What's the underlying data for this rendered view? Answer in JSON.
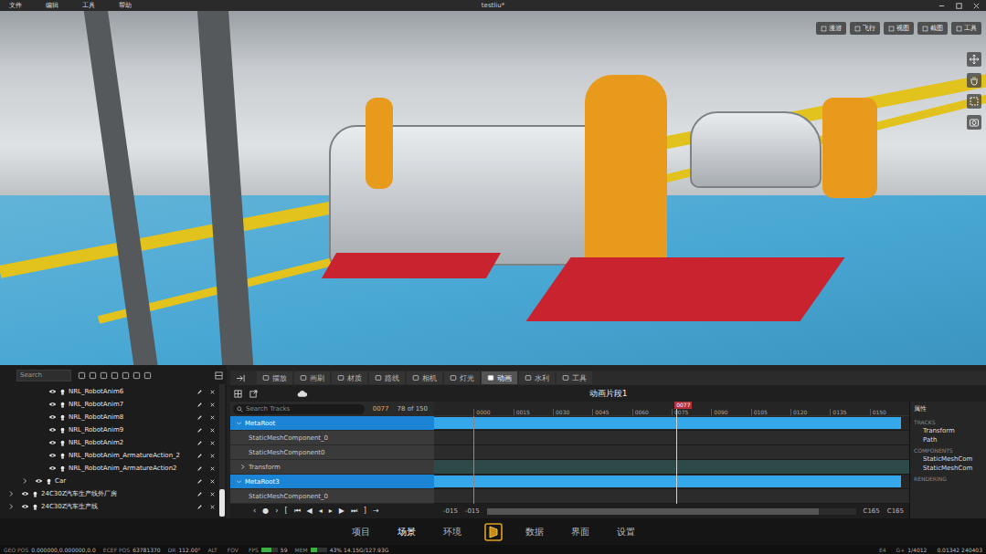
{
  "window": {
    "title": "testliu*",
    "menu": [
      "文件",
      "编辑",
      "工具",
      "帮助"
    ]
  },
  "viewport": {
    "toolbar": [
      "漫游",
      "飞行",
      "视图",
      "截图",
      "工具"
    ]
  },
  "scene_tree": {
    "search": {
      "placeholder": "Search"
    },
    "items": [
      {
        "label": "NRL_RobotAnim6",
        "depth": 2,
        "has_children": false,
        "expanded": false
      },
      {
        "label": "NRL_RobotAnim7",
        "depth": 2,
        "has_children": false,
        "expanded": false
      },
      {
        "label": "NRL_RobotAnim8",
        "depth": 2,
        "has_children": false,
        "expanded": false
      },
      {
        "label": "NRL_RobotAnim9",
        "depth": 2,
        "has_children": false,
        "expanded": false
      },
      {
        "label": "NRL_RobotAnim2",
        "depth": 2,
        "has_children": false,
        "expanded": false
      },
      {
        "label": "NRL_RobotAnim_ArmatureAction_2",
        "depth": 2,
        "has_children": false,
        "expanded": false
      },
      {
        "label": "NRL_RobotAnim_ArmatureAction2",
        "depth": 2,
        "has_children": false,
        "expanded": false
      },
      {
        "label": "Car",
        "depth": 1,
        "has_children": true,
        "expanded": false
      },
      {
        "label": "24C30Z汽车生产线外厂房",
        "depth": 0,
        "has_children": true,
        "expanded": false
      },
      {
        "label": "24C30Z汽车生产线",
        "depth": 0,
        "has_children": true,
        "expanded": false
      }
    ]
  },
  "editor": {
    "tabs": [
      {
        "label": "摆放",
        "selected": false
      },
      {
        "label": "画刷",
        "selected": false
      },
      {
        "label": "材质",
        "selected": false
      },
      {
        "label": "路线",
        "selected": false
      },
      {
        "label": "相机",
        "selected": false
      },
      {
        "label": "灯光",
        "selected": false
      },
      {
        "label": "动画",
        "selected": true
      },
      {
        "label": "水利",
        "selected": false
      },
      {
        "label": "工具",
        "selected": false
      }
    ],
    "clip_title": "动画片段1",
    "tracks": {
      "search": {
        "placeholder": "Search Tracks"
      },
      "frame": "0077",
      "count": "78 of 150",
      "rows": [
        {
          "label": "MetaRoot",
          "kind": "group",
          "selected": true,
          "expanded": true
        },
        {
          "label": "StaticMeshComponent_0",
          "kind": "component",
          "selected": false,
          "expanded": false
        },
        {
          "label": "StaticMeshComponent0",
          "kind": "component",
          "selected": false,
          "expanded": false
        },
        {
          "label": "Transform",
          "kind": "folder",
          "selected": false,
          "expanded": false
        },
        {
          "label": "MetaRoot3",
          "kind": "group",
          "selected": true,
          "expanded": true
        },
        {
          "label": "StaticMeshComponent_0",
          "kind": "component",
          "selected": false,
          "expanded": false
        }
      ]
    },
    "timeline": {
      "ticks": [
        "0000",
        "0015",
        "0030",
        "0045",
        "0060",
        "0075",
        "0090",
        "0105",
        "0120",
        "0135",
        "0150"
      ],
      "playhead": {
        "label": "0077",
        "level": 0.51
      }
    },
    "controls": [
      "‹",
      "●",
      "›",
      "[",
      "⏮",
      "◀",
      "◂",
      "▸",
      "▶",
      "⏭",
      "]",
      "→"
    ],
    "range": {
      "start": "-015",
      "view_start": "-015",
      "view_end": "C165",
      "end": "C165",
      "scroll_level": 0.9
    }
  },
  "properties": {
    "title": "属性",
    "sections": [
      {
        "title": "TRACKS",
        "items": [
          "Transform",
          "Path"
        ]
      },
      {
        "title": "COMPONENTS",
        "items": [
          "StaticMeshCom",
          "StaticMeshCom"
        ]
      },
      {
        "title": "RENDERING",
        "items": []
      }
    ]
  },
  "dock": {
    "items": [
      {
        "kind": "tab",
        "label": "项目",
        "selected": false
      },
      {
        "kind": "tab",
        "label": "场景",
        "selected": true
      },
      {
        "kind": "tab",
        "label": "环境",
        "selected": false
      },
      {
        "kind": "logo",
        "label": "",
        "selected": false
      },
      {
        "kind": "tab",
        "label": "数据",
        "selected": false
      },
      {
        "kind": "tab",
        "label": "界面",
        "selected": false
      },
      {
        "kind": "tab",
        "label": "设置",
        "selected": false
      }
    ]
  },
  "status_bar": {
    "left": [
      {
        "label": "GEO POS",
        "value": "0.000000,0.000000,0.0"
      },
      {
        "label": "ECEF POS",
        "value": "63781370"
      },
      {
        "label": "DR",
        "value": "112.00°"
      },
      {
        "label": "ALT",
        "value": ""
      },
      {
        "label": "FOV",
        "value": ""
      },
      {
        "label": "FPS",
        "value": "59",
        "level": 0.6,
        "color": "#3cb043"
      },
      {
        "label": "MEM",
        "value": "43%  14.15G/127.93G",
        "level": 0.43,
        "color": "#3cb043"
      }
    ],
    "right": [
      {
        "label": "E4",
        "value": ""
      },
      {
        "label": "G+",
        "value": "1/4012"
      },
      {
        "label": "",
        "value": "0.01342 240403"
      }
    ]
  }
}
